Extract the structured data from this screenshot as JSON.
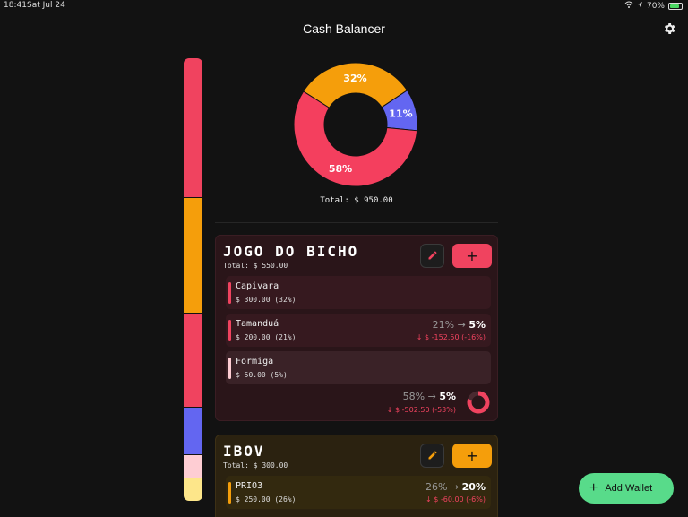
{
  "status": {
    "time": "18:41",
    "date": "Sat Jul 24",
    "battery": "70%"
  },
  "app": {
    "title": "Cash Balancer"
  },
  "donut": {
    "segments": [
      {
        "label": "32%",
        "value": 32,
        "color": "#f59e0b"
      },
      {
        "label": "11%",
        "value": 11,
        "color": "#6366f1"
      },
      {
        "label": "58%",
        "value": 58,
        "color": "#f43f5e"
      }
    ],
    "total": "Total: $ 950.00"
  },
  "sidebar_segments": [
    {
      "color": "#f0435f",
      "value": 31
    },
    {
      "color": "#f59e0b",
      "value": 26
    },
    {
      "color": "#f0435f",
      "value": 21
    },
    {
      "color": "#6366f1",
      "value": 10.5
    },
    {
      "color": "#fecdd3",
      "value": 5.3
    },
    {
      "color": "#fde68a",
      "value": 5.2
    }
  ],
  "wallets": [
    {
      "name": "JOGO DO BICHO",
      "total": "Total: $ 550.00",
      "color": "#f0435f",
      "assets": [
        {
          "name": "Capivara",
          "value": "$ 300.00 (32%)",
          "current": "",
          "target": "",
          "delta": "",
          "bar_color": "#f0435f"
        },
        {
          "name": "Tamanduá",
          "value": "$ 200.00 (21%)",
          "current": "21%",
          "target": "5%",
          "delta": "$ -152.50 (-16%)",
          "bar_color": "#f0435f"
        },
        {
          "name": "Formiga",
          "value": "$ 50.00 (5%)",
          "current": "",
          "target": "",
          "delta": "",
          "bar_color": "#fecdd3"
        }
      ],
      "summary": {
        "current": "58%",
        "target": "5%",
        "delta": "$ -502.50 (-53%)"
      }
    },
    {
      "name": "IBOV",
      "total": "Total: $ 300.00",
      "color": "#f59e0b",
      "assets": [
        {
          "name": "PRIO3",
          "value": "$ 250.00 (26%)",
          "current": "26%",
          "target": "20%",
          "delta": "$ -60.00 (-6%)",
          "bar_color": "#f59e0b"
        }
      ]
    }
  ],
  "actions": {
    "add_wallet": "Add Wallet",
    "add_symbol": "+"
  }
}
